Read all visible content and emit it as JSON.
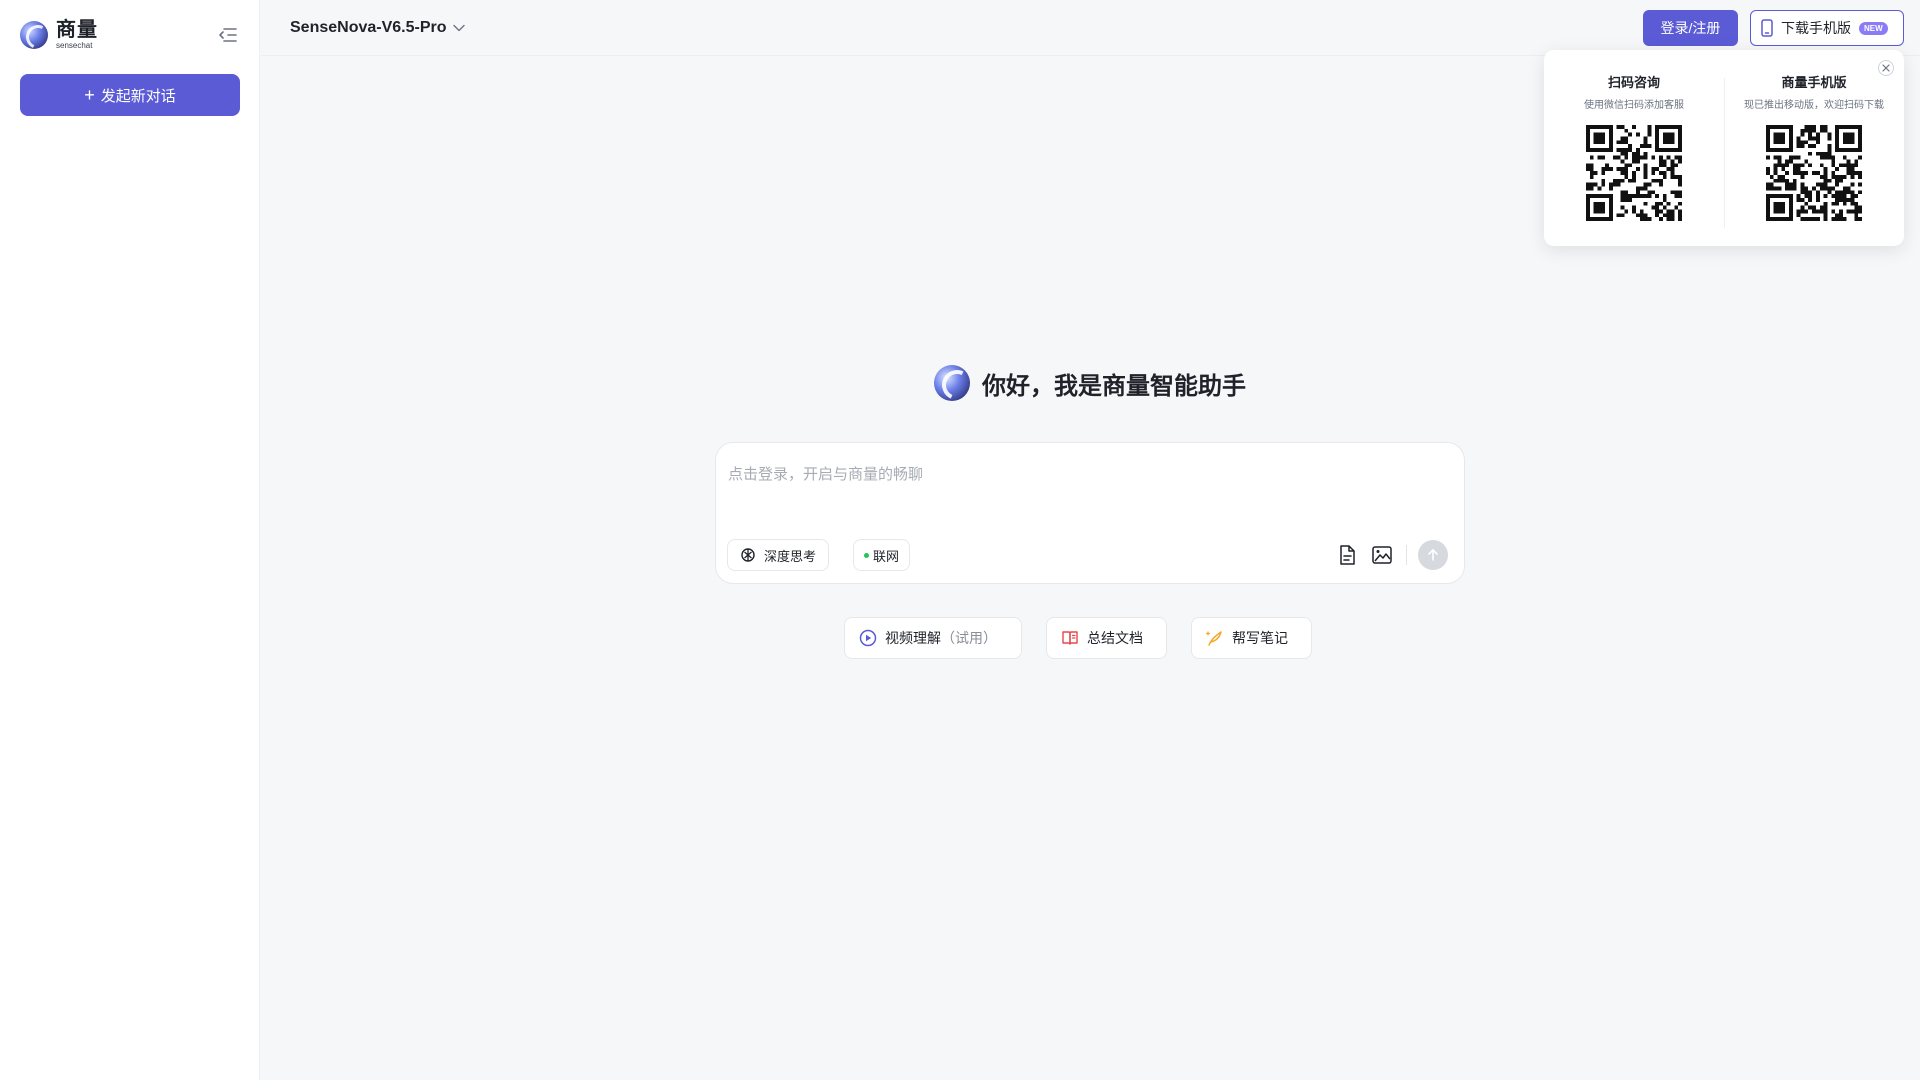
{
  "app": {
    "logo_cn": "商量",
    "logo_en": "sensechat",
    "brand_color": "#5b5bd6"
  },
  "sidebar": {
    "new_chat_label": "发起新对话",
    "collapse_icon": "collapse-sidebar-icon"
  },
  "header": {
    "model_name": "SenseNova-V6.5-Pro",
    "login_label": "登录/注册",
    "download_label": "下载手机版",
    "download_badge": "NEW"
  },
  "qr_popup": {
    "left_title": "扫码咨询",
    "left_subtitle": "使用微信扫码添加客服",
    "right_title": "商量手机版",
    "right_subtitle": "现已推出移动版，欢迎扫码下载"
  },
  "hero": {
    "greeting": "你好，我是商量智能助手"
  },
  "input": {
    "placeholder": "点击登录，开启与商量的畅聊",
    "deep_think_label": "深度思考",
    "web_label": "联网"
  },
  "quick_actions": {
    "video_label": "视频理解",
    "video_note": "（试用）",
    "summary_label": "总结文档",
    "notes_label": "帮写笔记"
  }
}
